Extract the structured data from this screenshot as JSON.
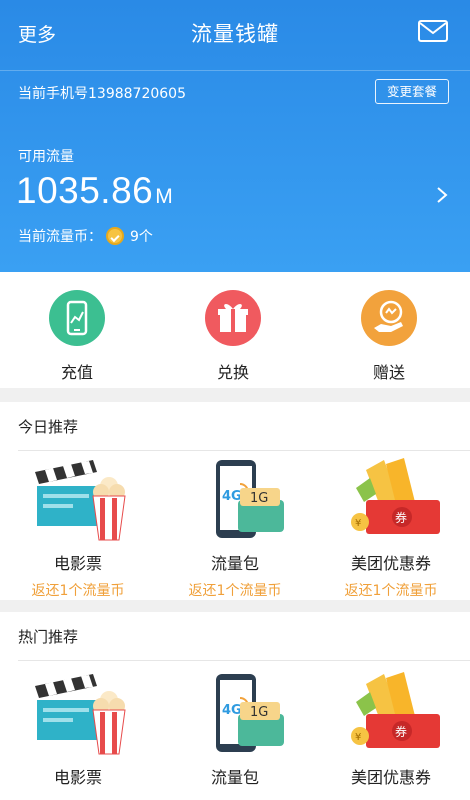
{
  "header": {
    "back_label": "更多",
    "title": "流量钱罐",
    "mail_icon": "mail-icon"
  },
  "account": {
    "phone_label": "当前手机号13988720605",
    "change_plan_label": "变更套餐",
    "available_label": "可用流量",
    "amount": "1035.86",
    "amount_unit": "M",
    "coins_label": "当前流量币：",
    "coins_value": "9个"
  },
  "actions": [
    {
      "label": "充值",
      "icon": "phone-chart-icon",
      "color": "#3cbf91"
    },
    {
      "label": "兑换",
      "icon": "gift-icon",
      "color": "#f05a5f"
    },
    {
      "label": "赠送",
      "icon": "give-hand-icon",
      "color": "#f2a23c"
    }
  ],
  "today": {
    "title": "今日推荐",
    "items": [
      {
        "name": "电影票",
        "sub": "返还1个流量币",
        "icon": "movie-ticket-icon"
      },
      {
        "name": "流量包",
        "sub": "返还1个流量币",
        "icon": "data-pack-icon"
      },
      {
        "name": "美团优惠券",
        "sub": "返还1个流量币",
        "icon": "coupon-icon"
      }
    ]
  },
  "hot": {
    "title": "热门推荐",
    "items": [
      {
        "name": "电影票",
        "icon": "movie-ticket-icon"
      },
      {
        "name": "流量包",
        "icon": "data-pack-icon"
      },
      {
        "name": "美团优惠券",
        "icon": "coupon-icon"
      }
    ]
  },
  "pack_badge": "1G",
  "pack_net": "4G",
  "coupon_badge": "券"
}
